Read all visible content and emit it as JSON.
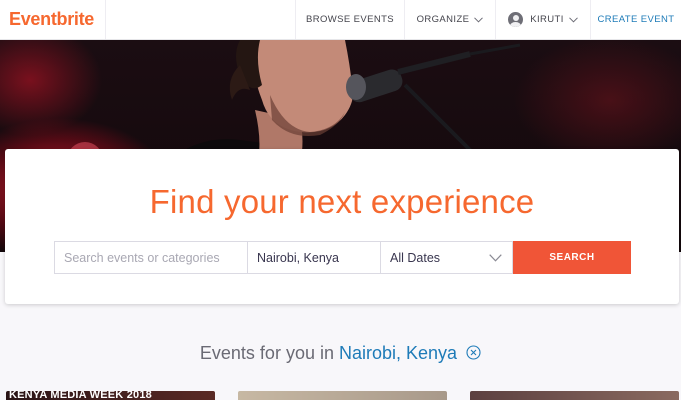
{
  "header": {
    "logo": "Eventbrite",
    "nav": {
      "browse": "BROWSE EVENTS",
      "organize": "ORGANIZE",
      "user": "KIRUTI",
      "create": "CREATE EVENT"
    }
  },
  "hero": {
    "tagline": "Find your next experience"
  },
  "search": {
    "keyword_placeholder": "Search events or categories",
    "location_value": "Nairobi, Kenya",
    "date_value": "All Dates",
    "button_label": "SEARCH"
  },
  "events": {
    "heading_prefix": "Events for you in",
    "location": "Nairobi, Kenya",
    "cards": [
      {
        "title": "KENYA MEDIA WEEK 2018"
      }
    ]
  },
  "colors": {
    "brand": "#f6682f",
    "link": "#1e7bb8",
    "search_button": "#f05537"
  }
}
